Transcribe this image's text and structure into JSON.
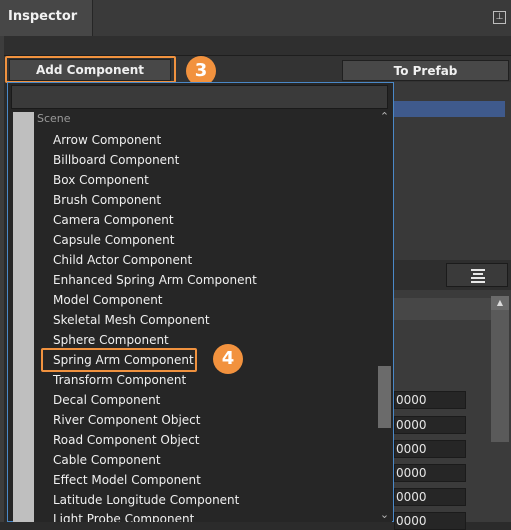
{
  "window": {
    "tab_title": "Inspector"
  },
  "toolbar": {
    "add_component_label": "Add Component",
    "to_prefab_label": "To Prefab"
  },
  "callouts": {
    "step_3": "3",
    "step_4": "4"
  },
  "dropdown": {
    "category": "Scene",
    "items": [
      "Arrow Component",
      "Billboard Component",
      "Box Component",
      "Brush Component",
      "Camera Component",
      "Capsule Component",
      "Child Actor Component",
      "Enhanced Spring Arm Component",
      "Model Component",
      "Skeletal Mesh Component",
      "Sphere Component",
      "Spring Arm Component",
      "Transform Component",
      "Decal Component",
      "River Component Object",
      "Road Component Object",
      "Cable Component",
      "Effect Model Component",
      "Latitude Longitude Component",
      "Light Probe Component"
    ],
    "highlighted_item": "Spring Arm Component"
  },
  "fields": [
    "0000",
    "0000",
    "0000",
    "0000",
    "0000",
    "0000"
  ],
  "colors": {
    "highlight": "#f0923f",
    "selection": "#3f5a8c",
    "dropdown_border": "#4a88c7"
  }
}
